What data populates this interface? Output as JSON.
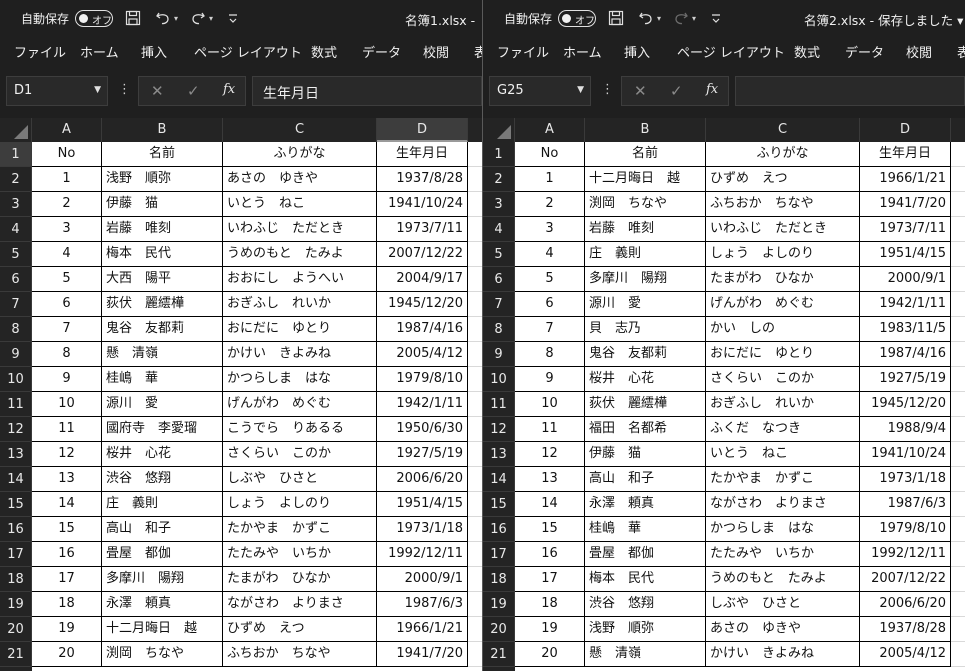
{
  "windows": [
    {
      "autosave_label": "自動保存",
      "autosave_toggle": "オフ",
      "filename": "名簿1.xlsx - ",
      "ribbon_tabs": [
        "ファイル",
        "ホーム",
        "挿入",
        "ページ レイアウト",
        "数式",
        "データ",
        "校閲",
        "表"
      ],
      "name_box": "D1",
      "formula": "生年月日",
      "selected_col": 3,
      "selected_row": 0,
      "columns": [
        "A",
        "B",
        "C",
        "D"
      ],
      "header": [
        "No",
        "名前",
        "ふりがな",
        "生年月日"
      ],
      "rows": [
        [
          "1",
          "浅野　順弥",
          "あさの　ゆきや",
          "1937/8/28"
        ],
        [
          "2",
          "伊藤　猫",
          "いとう　ねこ",
          "1941/10/24"
        ],
        [
          "3",
          "岩藤　唯刻",
          "いわふじ　ただとき",
          "1973/7/11"
        ],
        [
          "4",
          "梅本　民代",
          "うめのもと　たみよ",
          "2007/12/22"
        ],
        [
          "5",
          "大西　陽平",
          "おおにし　ようへい",
          "2004/9/17"
        ],
        [
          "6",
          "荻伏　麗繧樺",
          "おぎふし　れいか",
          "1945/12/20"
        ],
        [
          "7",
          "鬼谷　友都莉",
          "おにだに　ゆとり",
          "1987/4/16"
        ],
        [
          "8",
          "懸　清嶺",
          "かけい　きよみね",
          "2005/4/12"
        ],
        [
          "9",
          "桂嶋　華",
          "かつらしま　はな",
          "1979/8/10"
        ],
        [
          "10",
          "源川　愛",
          "げんがわ　めぐむ",
          "1942/1/11"
        ],
        [
          "11",
          "國府寺　李愛瑠",
          "こうでら　りあるる",
          "1950/6/30"
        ],
        [
          "12",
          "桜井　心花",
          "さくらい　このか",
          "1927/5/19"
        ],
        [
          "13",
          "渋谷　悠翔",
          "しぶや　ひさと",
          "2006/6/20"
        ],
        [
          "14",
          "庄　義則",
          "しょう　よしのり",
          "1951/4/15"
        ],
        [
          "15",
          "高山　和子",
          "たかやま　かずこ",
          "1973/1/18"
        ],
        [
          "16",
          "畳屋　都伽",
          "たたみや　いちか",
          "1992/12/11"
        ],
        [
          "17",
          "多摩川　陽翔",
          "たまがわ　ひなか",
          "2000/9/1"
        ],
        [
          "18",
          "永澤　頼真",
          "ながさわ　よりまさ",
          "1987/6/3"
        ],
        [
          "19",
          "十二月晦日　越",
          "ひずめ　えつ",
          "1966/1/21"
        ],
        [
          "20",
          "渕岡　ちなや",
          "ふちおか　ちなや",
          "1941/7/20"
        ]
      ]
    },
    {
      "autosave_label": "自動保存",
      "autosave_toggle": "オフ",
      "filename": "名簿2.xlsx - 保存しました ▾",
      "ribbon_tabs": [
        "ファイル",
        "ホーム",
        "挿入",
        "ページ レイアウト",
        "数式",
        "データ",
        "校閲",
        "表"
      ],
      "name_box": "G25",
      "formula": "",
      "selected_col": -1,
      "selected_row": -1,
      "columns": [
        "A",
        "B",
        "C",
        "D"
      ],
      "header": [
        "No",
        "名前",
        "ふりがな",
        "生年月日"
      ],
      "rows": [
        [
          "1",
          "十二月晦日　越",
          "ひずめ　えつ",
          "1966/1/21"
        ],
        [
          "2",
          "渕岡　ちなや",
          "ふちおか　ちなや",
          "1941/7/20"
        ],
        [
          "3",
          "岩藤　唯刻",
          "いわふじ　ただとき",
          "1973/7/11"
        ],
        [
          "4",
          "庄　義則",
          "しょう　よしのり",
          "1951/4/15"
        ],
        [
          "5",
          "多摩川　陽翔",
          "たまがわ　ひなか",
          "2000/9/1"
        ],
        [
          "6",
          "源川　愛",
          "げんがわ　めぐむ",
          "1942/1/11"
        ],
        [
          "7",
          "貝　志乃",
          "かい　しの",
          "1983/11/5"
        ],
        [
          "8",
          "鬼谷　友都莉",
          "おにだに　ゆとり",
          "1987/4/16"
        ],
        [
          "9",
          "桜井　心花",
          "さくらい　このか",
          "1927/5/19"
        ],
        [
          "10",
          "荻伏　麗繧樺",
          "おぎふし　れいか",
          "1945/12/20"
        ],
        [
          "11",
          "福田　名都希",
          "ふくだ　なつき",
          "1988/9/4"
        ],
        [
          "12",
          "伊藤　猫",
          "いとう　ねこ",
          "1941/10/24"
        ],
        [
          "13",
          "高山　和子",
          "たかやま　かずこ",
          "1973/1/18"
        ],
        [
          "14",
          "永澤　頼真",
          "ながさわ　よりまさ",
          "1987/6/3"
        ],
        [
          "15",
          "桂嶋　華",
          "かつらしま　はな",
          "1979/8/10"
        ],
        [
          "16",
          "畳屋　都伽",
          "たたみや　いちか",
          "1992/12/11"
        ],
        [
          "17",
          "梅本　民代",
          "うめのもと　たみよ",
          "2007/12/22"
        ],
        [
          "18",
          "渋谷　悠翔",
          "しぶや　ひさと",
          "2006/6/20"
        ],
        [
          "19",
          "浅野　順弥",
          "あさの　ゆきや",
          "1937/8/28"
        ],
        [
          "20",
          "懸　清嶺",
          "かけい　きよみね",
          "2005/4/12"
        ]
      ]
    }
  ]
}
